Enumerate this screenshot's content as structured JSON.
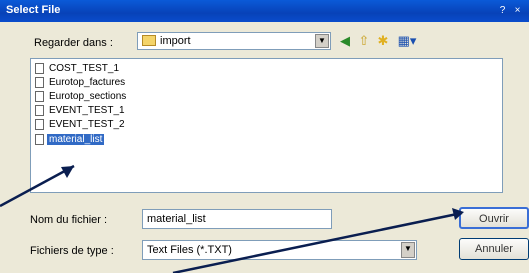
{
  "window": {
    "title": "Select File",
    "help_label": "?",
    "close_label": "×"
  },
  "lookin": {
    "label": "Regarder dans :",
    "value": "import",
    "dropdown_icon": "▼"
  },
  "toolbar": {
    "back_icon": "◀",
    "up_icon": "⇧",
    "newfolder_icon": "✱",
    "view_icon": "▦▾"
  },
  "files": [
    {
      "name": "COST_TEST_1",
      "selected": false
    },
    {
      "name": "Eurotop_factures",
      "selected": false
    },
    {
      "name": "Eurotop_sections",
      "selected": false
    },
    {
      "name": "EVENT_TEST_1",
      "selected": false
    },
    {
      "name": "EVENT_TEST_2",
      "selected": false
    },
    {
      "name": "material_list",
      "selected": true
    }
  ],
  "filename": {
    "label": "Nom du fichier :",
    "value": "material_list"
  },
  "filetype": {
    "label": "Fichiers de type :",
    "value": "Text Files (*.TXT)",
    "dropdown_icon": "▼"
  },
  "buttons": {
    "open": "Ouvrir",
    "cancel": "Annuler"
  }
}
